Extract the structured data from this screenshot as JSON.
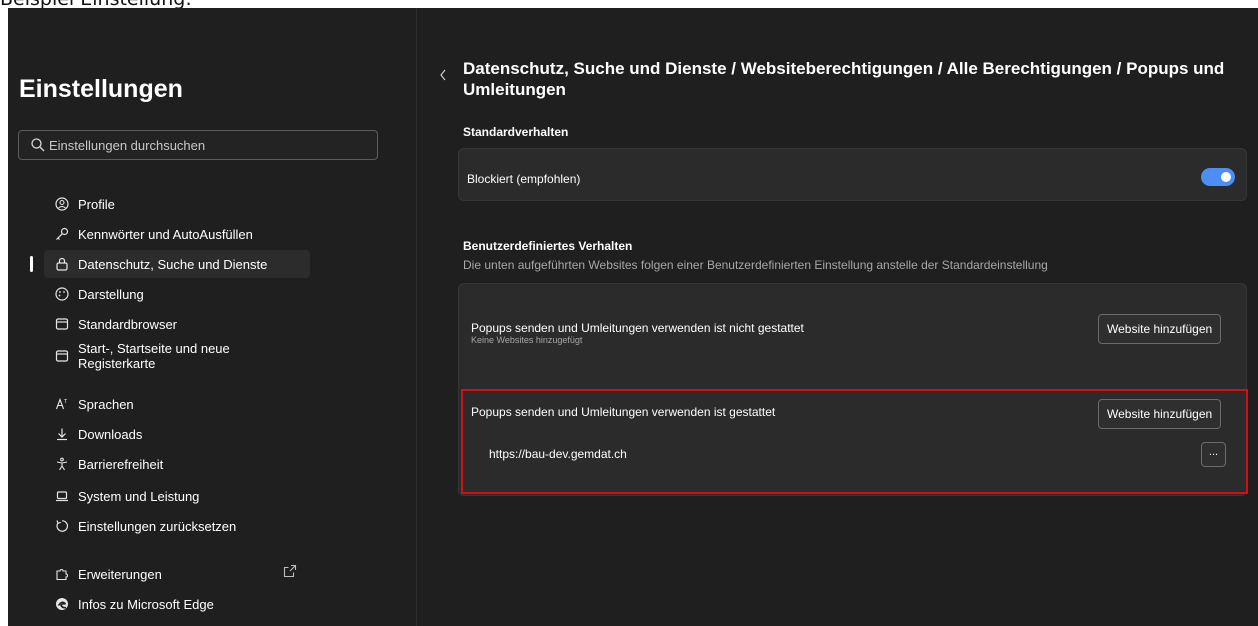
{
  "caption": "Beispiel Einstellung:",
  "sidebar": {
    "title": "Einstellungen",
    "search_placeholder": "Einstellungen durchsuchen",
    "items": [
      {
        "label": "Profile",
        "icon": "profile-icon"
      },
      {
        "label": "Kennwörter und AutoAusfüllen",
        "icon": "key-icon"
      },
      {
        "label": "Datenschutz, Suche und Dienste",
        "icon": "lock-icon",
        "active": true
      },
      {
        "label": "Darstellung",
        "icon": "palette-icon"
      },
      {
        "label": "Standardbrowser",
        "icon": "browser-icon"
      },
      {
        "label": "Start-, Startseite und neue Registerkarte",
        "icon": "home-tab-icon"
      },
      {
        "label": "Sprachen",
        "icon": "language-icon"
      },
      {
        "label": "Downloads",
        "icon": "download-icon"
      },
      {
        "label": "Barrierefreiheit",
        "icon": "accessibility-icon"
      },
      {
        "label": "System und Leistung",
        "icon": "laptop-icon"
      },
      {
        "label": "Einstellungen zurücksetzen",
        "icon": "reset-icon"
      },
      {
        "label": "Erweiterungen",
        "icon": "puzzle-icon",
        "external": true
      },
      {
        "label": "Infos zu Microsoft Edge",
        "icon": "edge-logo-icon"
      }
    ]
  },
  "main": {
    "breadcrumb": "Datenschutz, Suche und Dienste / Websiteberechtigungen / Alle Berechtigungen / Popups und Umleitungen",
    "default_section": {
      "label": "Standardverhalten",
      "setting_label": "Blockiert (empfohlen)",
      "toggle_on": true
    },
    "custom_section": {
      "label": "Benutzerdefiniertes Verhalten",
      "description": "Die unten aufgeführten Websites folgen einer Benutzerdefinierten Einstellung anstelle der Standardeinstellung",
      "blocked": {
        "title": "Popups senden und Umleitungen verwenden ist nicht gestattet",
        "empty_text": "Keine Websites hinzugefügt",
        "add_button": "Website hinzufügen"
      },
      "allowed": {
        "title": "Popups senden und Umleitungen verwenden ist gestattet",
        "add_button": "Website hinzufügen",
        "sites": [
          {
            "url": "https://bau-dev.gemdat.ch",
            "more_label": "..."
          }
        ]
      }
    }
  },
  "colors": {
    "background": "#1f1f1f",
    "card": "#2b2b2b",
    "toggle_accent": "#4c8df6",
    "highlight": "#d50d14"
  }
}
